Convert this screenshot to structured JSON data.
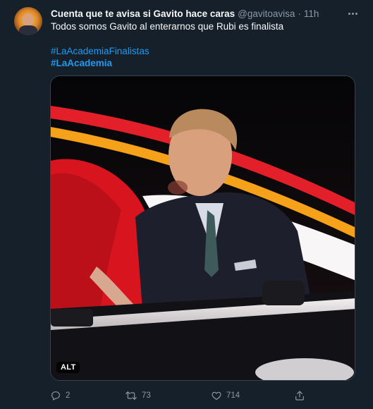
{
  "tweet": {
    "display_name": "Cuenta que te avisa si Gavito hace caras",
    "handle": "@gavitoavisa",
    "separator": "·",
    "time": "11h",
    "text": "Todos somos Gavito al enterarnos que Rubi es finalista",
    "hashtags": [
      "#LaAcademiaFinalistas",
      "#LaAcademia"
    ],
    "media": {
      "alt_label": "ALT"
    },
    "actions": {
      "reply_count": "2",
      "retweet_count": "73",
      "like_count": "714"
    }
  },
  "colors": {
    "background": "#15202b",
    "text": "#f7f9f9",
    "secondary_text": "#8b98a5",
    "link": "#1d9bf0",
    "border": "#38444d"
  },
  "icons": [
    "more-icon",
    "reply-icon",
    "retweet-icon",
    "like-icon",
    "share-icon"
  ]
}
